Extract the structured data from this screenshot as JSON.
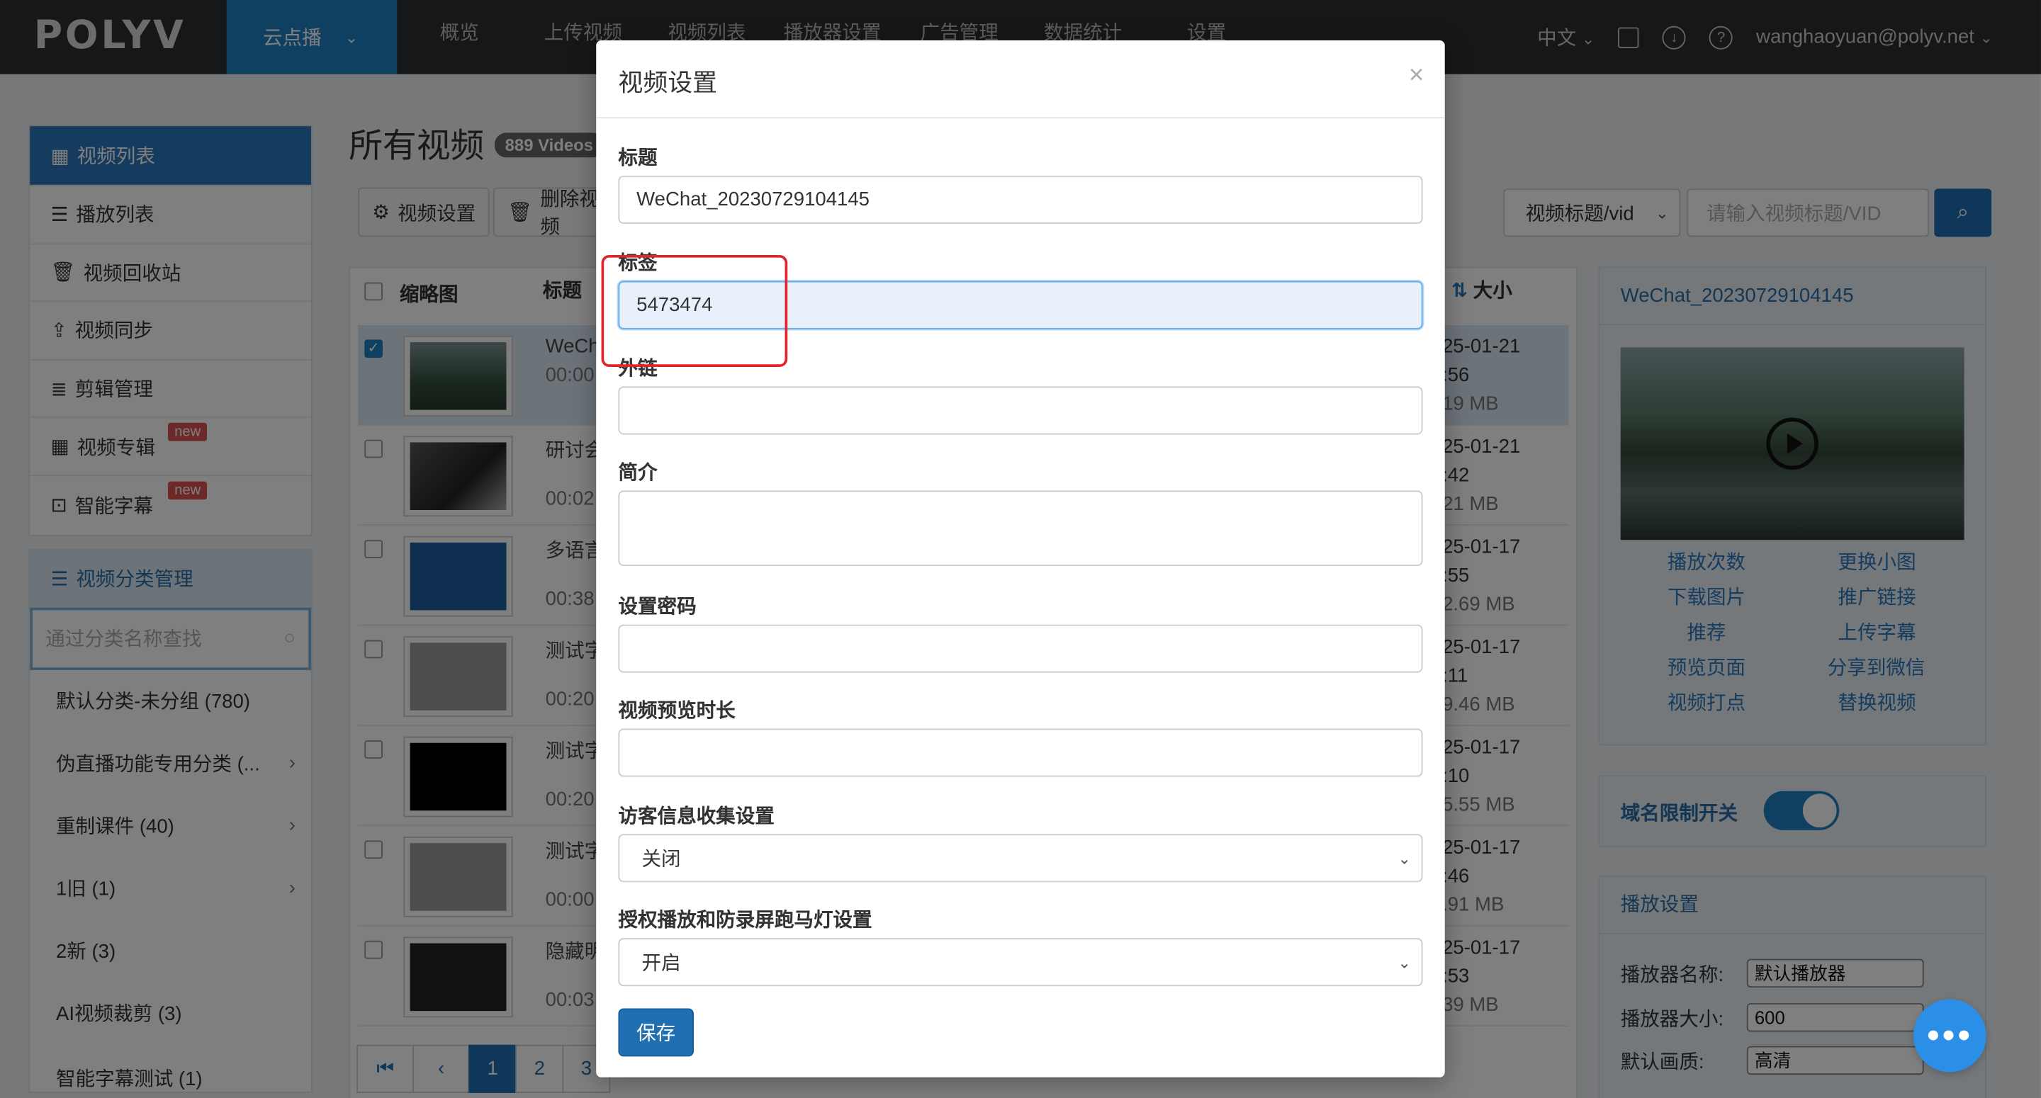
{
  "nav": {
    "logo": "POLYV",
    "active": "云点播",
    "items": [
      "概览",
      "上传视频",
      "视频列表",
      "播放器设置",
      "广告管理",
      "数据统计",
      "设置"
    ],
    "lang": "中文",
    "user": "wanghaoyuan@polyv.net"
  },
  "sidebar": {
    "items": [
      {
        "label": "视频列表",
        "active": true
      },
      {
        "label": "播放列表"
      },
      {
        "label": "视频回收站"
      },
      {
        "label": "视频同步"
      },
      {
        "label": "剪辑管理"
      },
      {
        "label": "视频专辑",
        "badge": "new"
      },
      {
        "label": "智能字幕",
        "badge": "new"
      }
    ],
    "category_title": "视频分类管理",
    "category_search_placeholder": "通过分类名称查找",
    "categories": [
      {
        "label": "默认分类-未分组 (780)"
      },
      {
        "label": "伪直播功能专用分类 (..."
      },
      {
        "label": "重制课件 (40)"
      },
      {
        "label": "1旧 (1)"
      },
      {
        "label": "2新 (3)"
      },
      {
        "label": "AI视频裁剪 (3)"
      },
      {
        "label": "智能字幕测试 (1)"
      }
    ]
  },
  "main": {
    "title": "所有视频",
    "count": "889 Videos",
    "btn_settings": "视频设置",
    "btn_delete": "删除视频",
    "search_select": "视频标题/vid",
    "search_placeholder": "请输入视频标题/VID",
    "col_thumb": "缩略图",
    "col_title": "标题",
    "col_size": "大小",
    "rows": [
      {
        "t1": "WeCh",
        "t2": "00:00",
        "d1": "25-01-21",
        "d2": ":56",
        "d3": "19 MB",
        "selected": true
      },
      {
        "t1": "研讨会",
        "t2": "00:02",
        "d1": "25-01-21",
        "d2": ":42",
        "d3": "21 MB"
      },
      {
        "t1": "多语言",
        "t2": "00:38",
        "d1": "25-01-17",
        "d2": ":55",
        "d3": "2.69 MB"
      },
      {
        "t1": "测试字",
        "t2": "00:20",
        "d1": "25-01-17",
        "d2": ":11",
        "d3": "9.46 MB"
      },
      {
        "t1": "测试字",
        "t2": "00:20",
        "d1": "25-01-17",
        "d2": ":10",
        "d3": "5.55 MB"
      },
      {
        "t1": "测试字",
        "t2": "00:00",
        "d1": "25-01-17",
        "d2": ":46",
        "d3": ".91 MB"
      },
      {
        "t1": "隐藏明",
        "t2": "00:03",
        "d1": "25-01-17",
        "d2": ":53",
        "d3": "39 MB"
      }
    ],
    "pager": [
      "1",
      "2",
      "3"
    ]
  },
  "right_panel": {
    "title": "WeChat_20230729104145",
    "links_left": [
      "播放次数",
      "下载图片",
      "推荐",
      "预览页面",
      "视频打点"
    ],
    "links_right": [
      "更换小图",
      "推广链接",
      "上传字幕",
      "分享到微信",
      "替换视频"
    ],
    "domain_toggle_label": "域名限制开关",
    "domain_toggle_on": true,
    "play_settings_title": "播放设置",
    "player_name_label": "播放器名称:",
    "player_name_value": "默认播放器",
    "player_size_label": "播放器大小:",
    "player_size_value": "600",
    "quality_label": "默认画质:",
    "quality_value": "高清"
  },
  "modal": {
    "title": "视频设置",
    "close": "×",
    "title_label": "标题",
    "title_value": "WeChat_20230729104145",
    "tag_label": "标签",
    "tag_value": "5473474",
    "link_label": "外链",
    "link_value": "",
    "intro_label": "简介",
    "password_label": "设置密码",
    "preview_label": "视频预览时长",
    "visitor_label": "访客信息收集设置",
    "visitor_value": "关闭",
    "auth_label": "授权播放和防录屏跑马灯设置",
    "auth_value": "开启",
    "save": "保存"
  },
  "colors": {
    "accent": "#1f6fb2",
    "nav_bg": "#2b2f33",
    "highlight": "#e0262a"
  }
}
